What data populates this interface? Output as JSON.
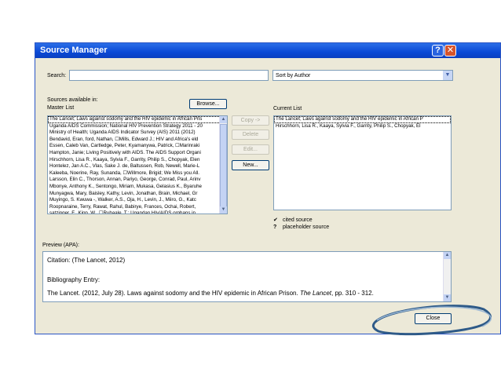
{
  "window": {
    "title": "Source Manager"
  },
  "search": {
    "label": "Search:",
    "value": ""
  },
  "sort": {
    "selected": "Sort by Author"
  },
  "master": {
    "sources_label": "Sources available in:",
    "list_label": "Master List",
    "browse_label": "Browse...",
    "items": [
      "The Lancet; Laws against sodomy and the HIV epidemic in African Pris",
      "Uganda AIDS Commission; National HIV Prevention Strategy 2011 - 20",
      "Ministry of Health; Uganda AIDS Indicator Survey (AIS) 2011 (2012)",
      "Bendavid, Eran, ford, Nathan, ☐Mills, Edward J.; HIV and Africa's eld",
      "Essen, Caleb Van, Cartledge, Peter, Kyamanywa, Patrick, ☐Marinraki",
      "Hampton, Janie; Living Positively with AIDS. The AIDS Support Organi",
      "Hirschhorn, Lisa R., Kaaya, Sylvia F., Garrity, Philip S., Chopyak, Elen",
      "Hontelez, Jan A.C., Vlas, Sake J. de, Baltussen, Rob, Newell, Marie-L",
      "Kaleeba, Noerine, Ray, Sunanda, ☐Willmore, Brigid; We Miss you All.",
      "Larsson, Elin C., Thorson, Annan, Pariyo, George, Conrad, Paul, Arinv",
      "Mbonye, Anthony K., Sentongo, Miriam, Mukasa, Gelasius K., Byaruhe",
      "Munyagwa, Mary, Baisley, Kathy, Levin, Jonathan, Brain, Michael, Gr",
      "Muyingo, S. Kwuwa -, Walker, A.S., Oja, H., Levin, J., Miiro, G., Katc",
      "Roopnaraine, Terry, Rawat, Rahul, Babirye, Frances, Ochai, Robert,",
      "satzinger, F., Kipp, W., ☐Rubaale, T.; Ugandan HIv/AIDS orphans in"
    ]
  },
  "actions": {
    "copy": "Copy ->",
    "delete": "Delete",
    "edit": "Edit...",
    "new": "New..."
  },
  "current": {
    "label": "Current List",
    "items": [
      "The Lancet; Laws against sodomy and the HIV epidemic in African P",
      "Hirschhorn, Lisa R., Kaaya, Sylvia F., Garrity, Philip S., Chopyak, El"
    ]
  },
  "legend": {
    "cited_symbol": "✔",
    "cited_label": "cited source",
    "placeholder_symbol": "?",
    "placeholder_label": "placeholder source"
  },
  "preview": {
    "label": "Preview (APA):",
    "citation": "Citation: (The Lancet, 2012)",
    "bibliography_heading": "Bibliography Entry:",
    "bib_text_before": "The Lancet. (2012, July 28). Laws against sodomy and the HIV epidemic in African Prison.",
    "bib_journal": "The Lancet",
    "bib_text_after": ", pp. 310 - 312."
  },
  "close_button": "Close",
  "colors": {
    "titlebar": "#0a49d6",
    "dialog_bg": "#ece9d8",
    "annotation": "#2e5a88"
  }
}
